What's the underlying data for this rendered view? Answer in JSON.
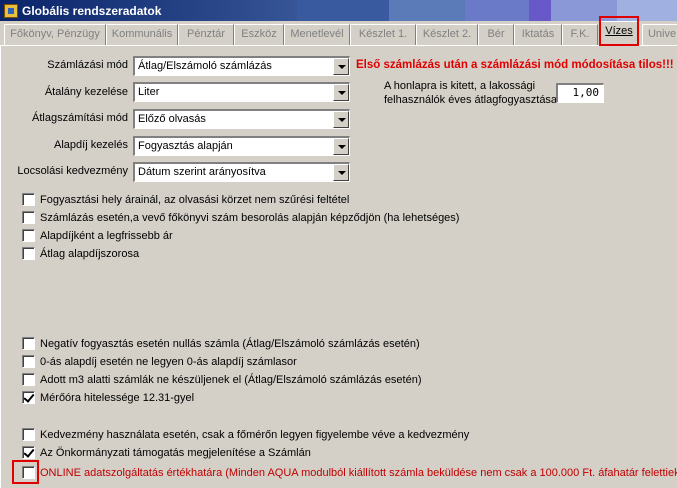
{
  "window": {
    "title": "Globális rendszeradatok"
  },
  "tabs": [
    {
      "label": "Főkönyv, Pénzügy"
    },
    {
      "label": "Kommunális"
    },
    {
      "label": "Pénztár"
    },
    {
      "label": "Eszköz"
    },
    {
      "label": "Menetlevél"
    },
    {
      "label": "Készlet 1."
    },
    {
      "label": "Készlet 2."
    },
    {
      "label": "Bér"
    },
    {
      "label": "Iktatás"
    },
    {
      "label": "F.K."
    },
    {
      "label": "Vízes"
    },
    {
      "label": "Unive"
    }
  ],
  "active_tab": "Vízes",
  "fields": {
    "szamlazasi_mod": {
      "label": "Számlázási mód",
      "value": "Átlag/Elszámoló számlázás"
    },
    "atalany_kezelese": {
      "label": "Átalány kezelése",
      "value": "Liter"
    },
    "atlagszamitasi_mod": {
      "label": "Átlagszámítási mód",
      "value": "Előző olvasás"
    },
    "alapdij_kezeles": {
      "label": "Alapdíj kezelés",
      "value": "Fogyasztás alapján"
    },
    "locsolasi_kedvezmeny": {
      "label": "Locsolási kedvezmény",
      "value": "Dátum szerint arányosítva"
    }
  },
  "warning": "Első számlázás után a számlázási mód módosítása tilos!!!",
  "info": {
    "line1": "A honlapra is kitett, a lakossági",
    "line2": "felhasználók éves átlagfogyasztása",
    "value": "1,00"
  },
  "checkboxes": {
    "fogyasztasi_hely": {
      "label": "Fogyasztási hely árainál, az olvasási körzet nem szűrési feltétel",
      "checked": false
    },
    "szamlazas_vevo": {
      "label": "Számlázás esetén,a vevő főkönyvi szám besorolás alapján  képződjön (ha lehetséges)",
      "checked": false
    },
    "alapdijkent": {
      "label": "Alapdíjként a legfrissebb ár",
      "checked": false
    },
    "atlag_alapdij": {
      "label": "Átlag alapdíjszorosa",
      "checked": false
    },
    "negativ": {
      "label": "Negatív fogyasztás esetén nullás számla (Átlag/Elszámoló számlázás esetén)",
      "checked": false
    },
    "nulla_alapdij": {
      "label": "0-ás alapdíj esetén ne legyen 0-ás alapdíj számlasor",
      "checked": false
    },
    "adott_m3": {
      "label": "Adott m3 alatti számlák ne készüljenek el (Átlag/Elszámoló számlázás esetén)",
      "checked": false
    },
    "merooora": {
      "label": "Mérőóra hitelessége 12.31-gyel",
      "checked": true
    },
    "kedvezmeny": {
      "label": "Kedvezmény használata esetén, csak a főmérőn legyen figyelembe véve a kedvezmény",
      "checked": false
    },
    "onkormanyzati": {
      "label": "Az Önkormányzati támogatás megjelenítése a Számlán",
      "checked": true
    },
    "online": {
      "label": "ONLINE adatszolgáltatás értékhatára (Minden AQUA modulból kiállított számla beküldése nem csak a 100.000 Ft. áfahatár felettiek)",
      "checked": false
    }
  },
  "colors": {
    "accent_red": "#e00000",
    "title_blue": "#0a246a"
  }
}
